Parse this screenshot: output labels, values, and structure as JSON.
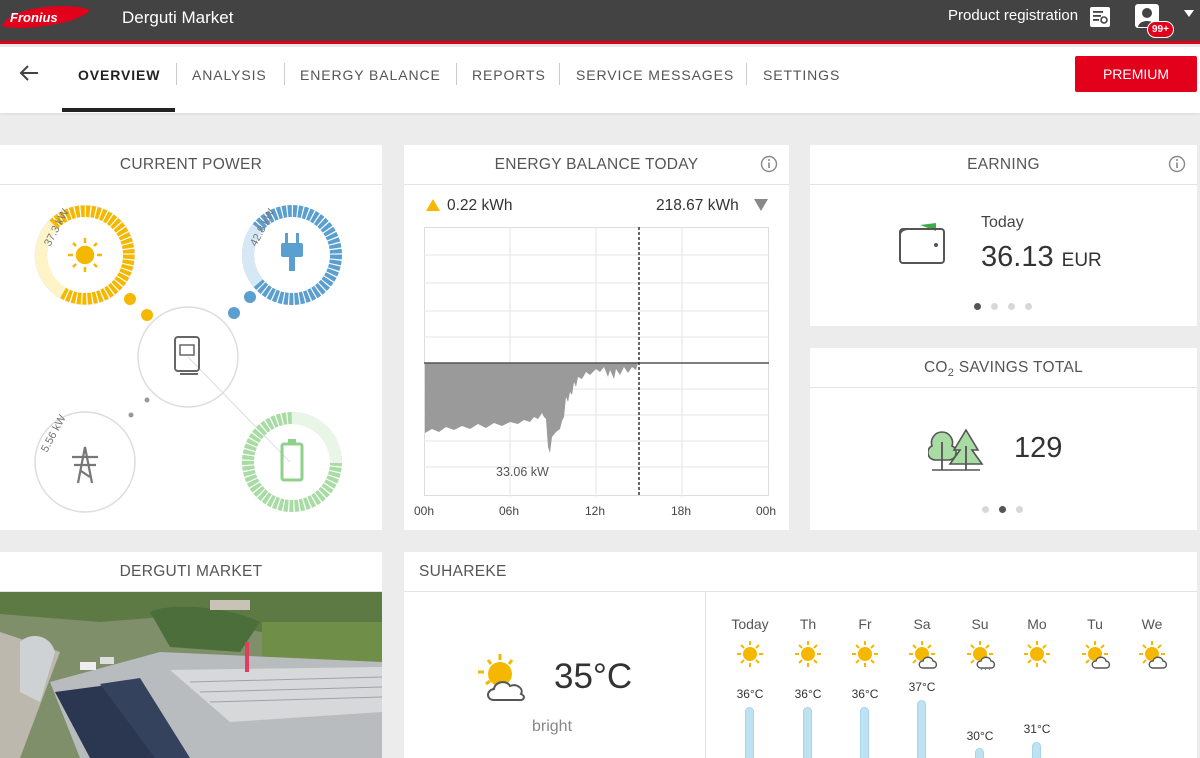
{
  "header": {
    "site_name": "Derguti Market",
    "product_registration": "Product registration",
    "notification_count": "99+"
  },
  "nav": {
    "tabs": [
      "OVERVIEW",
      "ANALYSIS",
      "ENERGY BALANCE",
      "REPORTS",
      "SERVICE MESSAGES",
      "SETTINGS"
    ],
    "active_tab": "OVERVIEW",
    "premium_label": "PREMIUM"
  },
  "current_power": {
    "title": "CURRENT POWER",
    "pv": "37.3 kW",
    "load": "42.8 kW",
    "grid": "5.56 kW",
    "colors": {
      "pv": "#f5b800",
      "load": "#5a9fcf",
      "grid": "#9a9a9a",
      "battery": "#8fd08a"
    }
  },
  "energy_balance": {
    "title": "ENERGY BALANCE TODAY",
    "produced": "0.22 kWh",
    "consumed": "218.67 kWh",
    "peak": "33.06 kW",
    "x_ticks": [
      "00h",
      "06h",
      "12h",
      "18h",
      "00h"
    ]
  },
  "earning": {
    "title": "EARNING",
    "label": "Today",
    "value": "36.13",
    "unit": "EUR"
  },
  "co2": {
    "title_prefix": "CO",
    "title_sub": "2",
    "title_suffix": " SAVINGS TOTAL",
    "value": "129"
  },
  "site": {
    "title": "DERGUTI MARKET"
  },
  "weather": {
    "title": "SUHAREKE",
    "current_temp": "35°C",
    "current_desc": "bright",
    "forecast": [
      {
        "day": "Today",
        "temp": "36°C",
        "icon": "sun-icon"
      },
      {
        "day": "Th",
        "temp": "36°C",
        "icon": "sun-icon"
      },
      {
        "day": "Fr",
        "temp": "36°C",
        "icon": "sun-icon"
      },
      {
        "day": "Sa",
        "temp": "37°C",
        "icon": "sun-cloud-icon"
      },
      {
        "day": "Su",
        "temp": "30°C",
        "icon": "sun-rain-icon"
      },
      {
        "day": "Mo",
        "temp": "31°C",
        "icon": "sun-icon"
      },
      {
        "day": "Tu",
        "temp": "",
        "icon": "sun-cloud-icon"
      },
      {
        "day": "We",
        "temp": "",
        "icon": "sun-cloud-icon"
      }
    ]
  }
}
